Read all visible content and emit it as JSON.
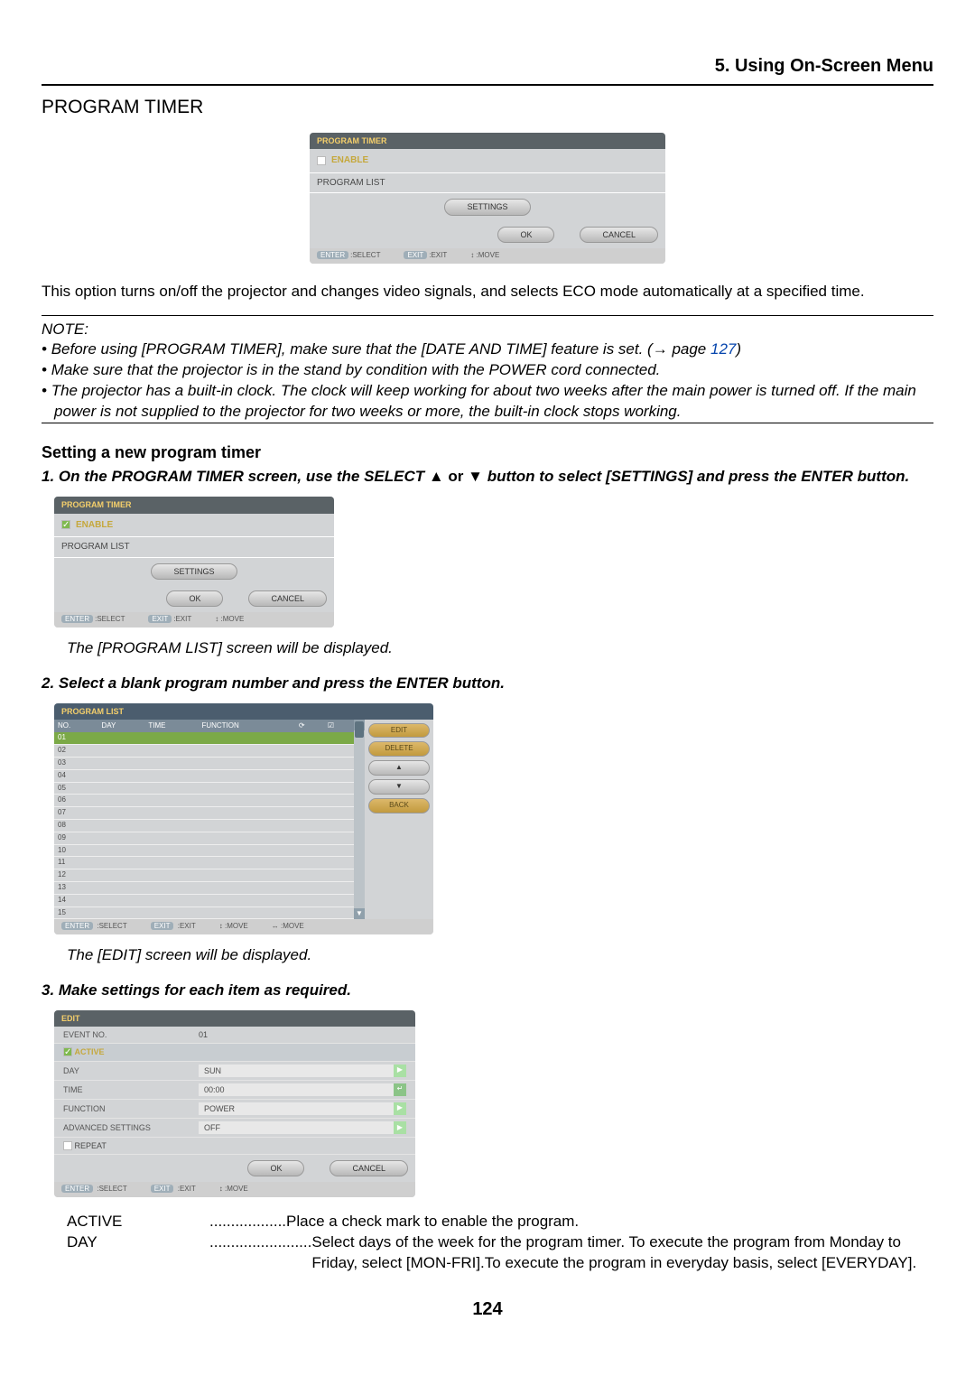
{
  "chapter": "5. Using On-Screen Menu",
  "section": "PROGRAM TIMER",
  "bodyText": "This option turns on/off the projector and changes video signals, and selects ECO mode automatically at a specified time.",
  "note": {
    "label": "NOTE:",
    "items": [
      {
        "pre": "Before using [PROGRAM TIMER], make sure that the [DATE AND TIME] feature is set. (→ page ",
        "link": "127",
        "post": ")"
      },
      {
        "pre": "Make sure that the projector is in the stand by condition with the POWER cord connected.",
        "link": "",
        "post": ""
      },
      {
        "pre": "The projector has a built-in clock. The clock will keep working for about two weeks after the main power is turned off. If the main power is not supplied to the projector for two weeks or more, the built-in clock stops working.",
        "link": "",
        "post": ""
      }
    ]
  },
  "subhead": "Setting a new program timer",
  "step1": {
    "num": "1.",
    "textA": "On the PROGRAM TIMER screen, use the SELECT ",
    "arrows": "▲ or ▼",
    "textB": " button to select [SETTINGS] and press the ENTER button."
  },
  "result1": "The [PROGRAM LIST] screen will be displayed.",
  "step2": {
    "num": "2.",
    "text": "Select a blank program number and press the ENTER button."
  },
  "result2": "The [EDIT] screen will be displayed.",
  "step3": {
    "num": "3.",
    "text": "Make settings for each item as required."
  },
  "definitions": [
    {
      "term": "ACTIVE",
      "dots": " .................. ",
      "desc": "Place a check mark to enable the program."
    },
    {
      "term": "DAY",
      "dots": "........................ ",
      "desc": "Select days of the week for the program timer. To execute the program from Monday to Friday, select [MON-FRI].To execute the program in everyday basis, select [EVERYDAY]."
    }
  ],
  "pageNumber": "124",
  "dlgTimer": {
    "title": "PROGRAM TIMER",
    "enable": "ENABLE",
    "programList": "PROGRAM LIST",
    "settings": "SETTINGS",
    "ok": "OK",
    "cancel": "CANCEL",
    "fSelect": ":SELECT",
    "fExit": ":EXIT",
    "fMove": ":MOVE",
    "enterKey": "ENTER",
    "exitKey": "EXIT"
  },
  "dlgList": {
    "title": "PROGRAM LIST",
    "cols": {
      "no": "NO.",
      "day": "DAY",
      "time": "TIME",
      "func": "FUNCTION",
      "rep": "⟳",
      "act": "☑"
    },
    "row": "01",
    "edit": "EDIT",
    "delete": "DELETE",
    "up": "▲",
    "down": "▼",
    "back": "BACK",
    "fSelect": ":SELECT",
    "fExit": ":EXIT",
    "fMove": ":MOVE",
    "fMove2": ":MOVE"
  },
  "dlgEdit": {
    "title": "EDIT",
    "eventNoLab": "EVENT NO.",
    "eventNo": "01",
    "active": "ACTIVE",
    "dayLab": "DAY",
    "day": "SUN",
    "timeLab": "TIME",
    "time": "00:00",
    "funcLab": "FUNCTION",
    "func": "POWER",
    "advLab": "ADVANCED SETTINGS",
    "adv": "OFF",
    "repeat": "REPEAT",
    "ok": "OK",
    "cancel": "CANCEL",
    "fSelect": ":SELECT",
    "fExit": ":EXIT",
    "fMove": ":MOVE"
  }
}
